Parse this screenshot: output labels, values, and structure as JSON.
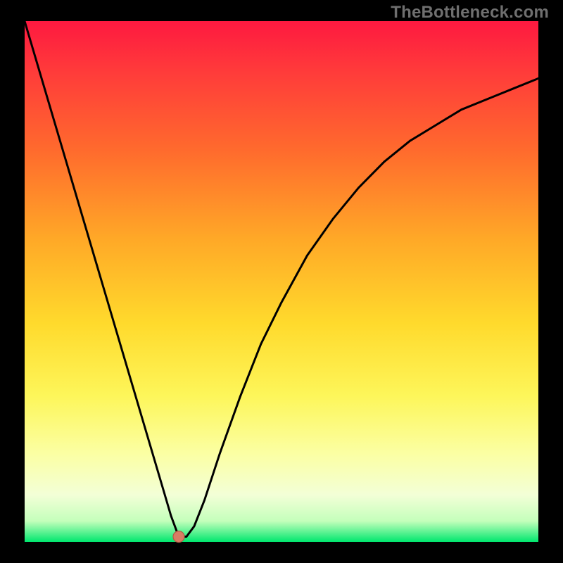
{
  "watermark": "TheBottleneck.com",
  "colors": {
    "background": "#000000",
    "curve": "#000000",
    "marker_fill": "#d87d64",
    "marker_stroke": "#b25a44"
  },
  "chart_data": {
    "type": "line",
    "title": "",
    "xlabel": "",
    "ylabel": "",
    "xlim": [
      0,
      100
    ],
    "ylim": [
      0,
      100
    ],
    "grid": false,
    "legend": false,
    "series": [
      {
        "name": "bottleneck-curve",
        "x": [
          0,
          3,
          6,
          9,
          12,
          15,
          18,
          21,
          24,
          27,
          28.5,
          30,
          31.5,
          33,
          35,
          38,
          42,
          46,
          50,
          55,
          60,
          65,
          70,
          75,
          80,
          85,
          90,
          95,
          100
        ],
        "y": [
          100,
          90,
          80,
          70,
          60,
          50,
          40,
          30,
          20,
          10,
          5,
          1,
          1,
          3,
          8,
          17,
          28,
          38,
          46,
          55,
          62,
          68,
          73,
          77,
          80,
          83,
          85,
          87,
          89
        ]
      }
    ],
    "annotations": [
      {
        "name": "optimal-point",
        "type": "marker",
        "x": 30,
        "y": 1
      }
    ]
  }
}
